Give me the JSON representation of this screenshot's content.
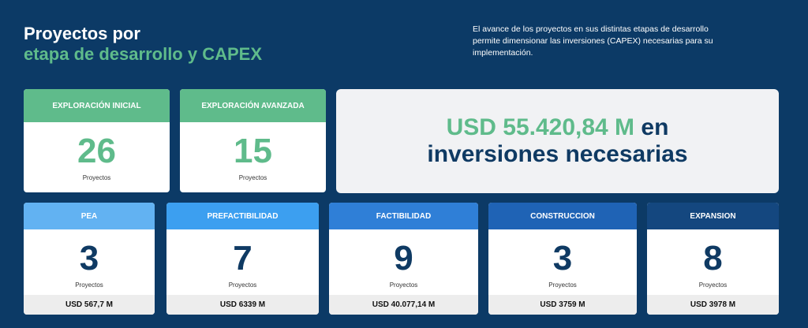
{
  "header": {
    "title_line1": "Proyectos por",
    "title_line2": "etapa de desarrollo y CAPEX",
    "description": "El avance de los proyectos en sus distintas etapas de desarrollo permite dimensionar las inversiones (CAPEX) necesarias para su implementación."
  },
  "top_cards": [
    {
      "stage": "EXPLORACIÓN INICIAL",
      "count": "26",
      "label": "Proyectos"
    },
    {
      "stage": "EXPLORACIÓN AVANZADA",
      "count": "15",
      "label": "Proyectos"
    }
  ],
  "capex": {
    "amount": "USD 55.420,84 M",
    "connector": " en",
    "text": "inversiones necesarias"
  },
  "bottom_cards": [
    {
      "stage": "PEA",
      "count": "3",
      "label": "Proyectos",
      "investment": "USD 567,7 M",
      "color": "#62b2f2"
    },
    {
      "stage": "PREFACTIBILIDAD",
      "count": "7",
      "label": "Proyectos",
      "investment": "USD 6339 M",
      "color": "#3c9ff0"
    },
    {
      "stage": "FACTIBILIDAD",
      "count": "9",
      "label": "Proyectos",
      "investment": "USD 40.077,14 M",
      "color": "#2f7fd7"
    },
    {
      "stage": "CONSTRUCCION",
      "count": "3",
      "label": "Proyectos",
      "investment": "USD 3759 M",
      "color": "#1f63b5"
    },
    {
      "stage": "EXPANSION",
      "count": "8",
      "label": "Proyectos",
      "investment": "USD 3978 M",
      "color": "#14477f"
    }
  ]
}
